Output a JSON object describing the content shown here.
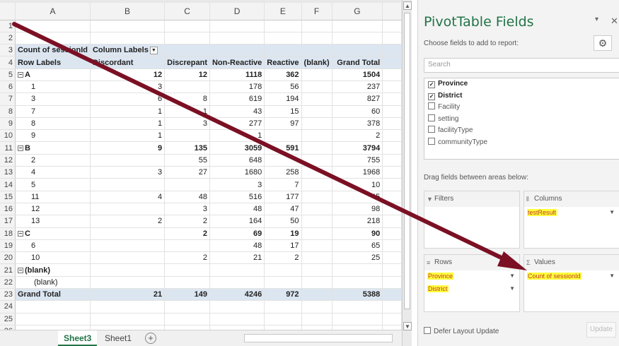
{
  "columns": [
    "A",
    "B",
    "C",
    "D",
    "E",
    "F",
    "G"
  ],
  "pivot_header": {
    "count_label": "Count of sessionId",
    "column_labels": "Column Labels",
    "row_labels": "Row Labels",
    "discordant": "Discordant",
    "discrepant": "Discrepant",
    "non_reactive": "Non-Reactive",
    "reactive": "Reactive",
    "blank": "(blank)",
    "grand_total": "Grand Total"
  },
  "rows": [
    {
      "num": "5",
      "label": "A",
      "kind": "prov",
      "vals": [
        "12",
        "12",
        "1118",
        "362",
        "",
        "1504"
      ]
    },
    {
      "num": "6",
      "label": "1",
      "kind": "dist",
      "vals": [
        "3",
        "",
        "178",
        "56",
        "",
        "237"
      ]
    },
    {
      "num": "7",
      "label": "3",
      "kind": "dist",
      "vals": [
        "6",
        "8",
        "619",
        "194",
        "",
        "827"
      ]
    },
    {
      "num": "8",
      "label": "7",
      "kind": "dist",
      "vals": [
        "1",
        "1",
        "43",
        "15",
        "",
        "60"
      ]
    },
    {
      "num": "9",
      "label": "8",
      "kind": "dist",
      "vals": [
        "1",
        "3",
        "277",
        "97",
        "",
        "378"
      ]
    },
    {
      "num": "10",
      "label": "9",
      "kind": "dist",
      "vals": [
        "1",
        "",
        "1",
        "",
        "",
        "2"
      ]
    },
    {
      "num": "11",
      "label": "B",
      "kind": "prov",
      "vals": [
        "9",
        "135",
        "3059",
        "591",
        "",
        "3794"
      ]
    },
    {
      "num": "12",
      "label": "2",
      "kind": "dist",
      "vals": [
        "",
        "55",
        "648",
        "",
        "",
        "755"
      ]
    },
    {
      "num": "13",
      "label": "4",
      "kind": "dist",
      "vals": [
        "3",
        "27",
        "1680",
        "258",
        "",
        "1968"
      ]
    },
    {
      "num": "14",
      "label": "5",
      "kind": "dist",
      "vals": [
        "",
        "",
        "3",
        "7",
        "",
        "10"
      ]
    },
    {
      "num": "15",
      "label": "11",
      "kind": "dist",
      "vals": [
        "4",
        "48",
        "516",
        "177",
        "",
        "45"
      ]
    },
    {
      "num": "16",
      "label": "12",
      "kind": "dist",
      "vals": [
        "",
        "3",
        "48",
        "47",
        "",
        "98"
      ]
    },
    {
      "num": "17",
      "label": "13",
      "kind": "dist",
      "vals": [
        "2",
        "2",
        "164",
        "50",
        "",
        "218"
      ]
    },
    {
      "num": "18",
      "label": "C",
      "kind": "prov",
      "vals": [
        "",
        "2",
        "69",
        "19",
        "",
        "90"
      ]
    },
    {
      "num": "19",
      "label": "6",
      "kind": "dist",
      "vals": [
        "",
        "",
        "48",
        "17",
        "",
        "65"
      ]
    },
    {
      "num": "20",
      "label": "10",
      "kind": "dist",
      "vals": [
        "",
        "2",
        "21",
        "2",
        "",
        "25"
      ]
    },
    {
      "num": "21",
      "label": "(blank)",
      "kind": "prov",
      "vals": [
        "",
        "",
        "",
        "",
        "",
        ""
      ]
    },
    {
      "num": "22",
      "label": "(blank)",
      "kind": "dist",
      "vals": [
        "",
        "",
        "",
        "",
        "",
        ""
      ]
    },
    {
      "num": "23",
      "label": "Grand Total",
      "kind": "gt",
      "vals": [
        "21",
        "149",
        "4246",
        "972",
        "",
        "5388"
      ]
    },
    {
      "num": "24",
      "label": "",
      "kind": "empty",
      "vals": [
        "",
        "",
        "",
        "",
        "",
        ""
      ]
    },
    {
      "num": "25",
      "label": "",
      "kind": "empty",
      "vals": [
        "",
        "",
        "",
        "",
        "",
        ""
      ]
    },
    {
      "num": "26",
      "label": "",
      "kind": "empty",
      "vals": [
        "",
        "",
        "",
        "",
        "",
        ""
      ]
    }
  ],
  "tabs": {
    "sheet3": "Sheet3",
    "sheet1": "Sheet1",
    "add": "+"
  },
  "panel": {
    "title": "PivotTable Fields",
    "choose": "Choose fields to add to report:",
    "search_placeholder": "Search",
    "fields": [
      {
        "name": "Province",
        "checked": true
      },
      {
        "name": "District",
        "checked": true
      },
      {
        "name": "Facility",
        "checked": false
      },
      {
        "name": "setting",
        "checked": false
      },
      {
        "name": "facilityType",
        "checked": false
      },
      {
        "name": "communityType",
        "checked": false
      }
    ],
    "drag": "Drag fields between areas below:",
    "filters": "Filters",
    "columns_area": "Columns",
    "rows_area": "Rows",
    "values_area": "Values",
    "columns_chip": "testResult",
    "rows_chips": [
      "Province",
      "District"
    ],
    "values_chip": "Count of sessionId",
    "defer": "Defer Layout Update",
    "update": "Update"
  },
  "colors": {
    "accent": "#217346",
    "arrow": "#7b1024",
    "highlight": "#ffff3b"
  }
}
